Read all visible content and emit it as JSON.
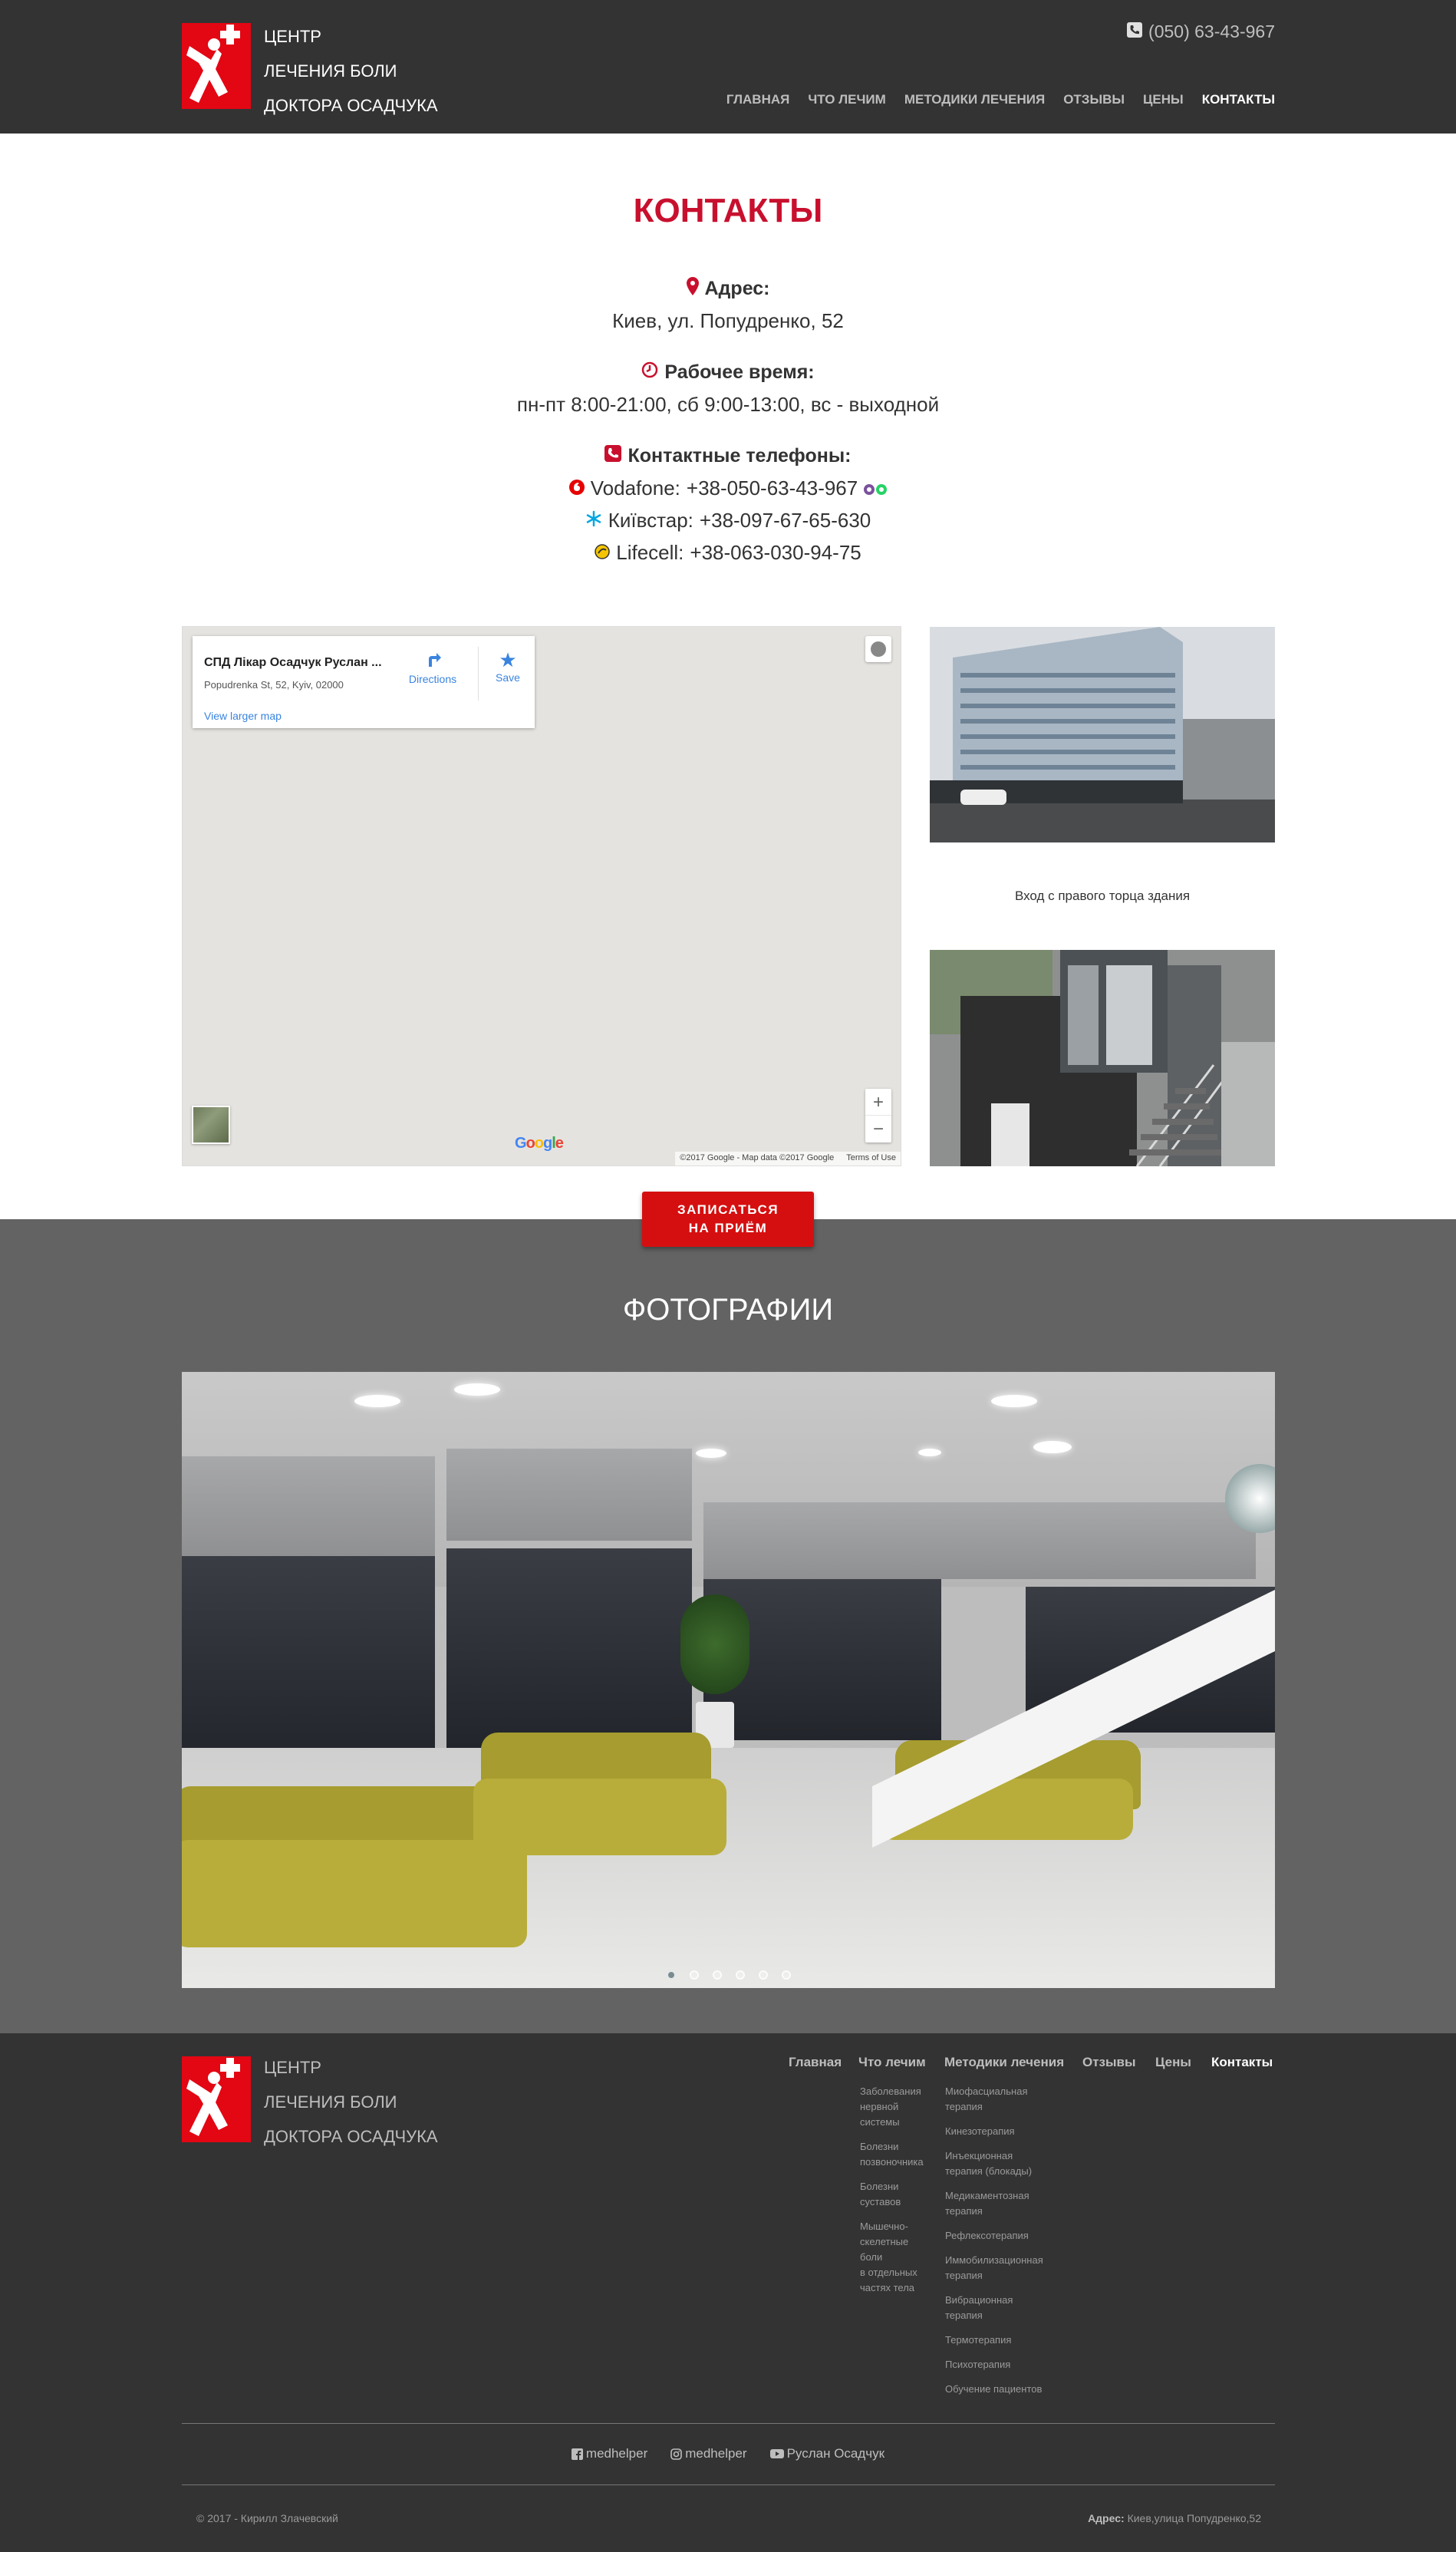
{
  "header": {
    "logo_lines": [
      "ЦЕНТР",
      "ЛЕЧЕНИЯ БОЛИ",
      "ДОКТОРА ОСАДЧУКА"
    ],
    "phone": "(050) 63-43-967",
    "nav": [
      {
        "label": "ГЛАВНАЯ",
        "active": false
      },
      {
        "label": "ЧТО ЛЕЧИМ",
        "active": false
      },
      {
        "label": "МЕТОДИКИ ЛЕЧЕНИЯ",
        "active": false
      },
      {
        "label": "ОТЗЫВЫ",
        "active": false
      },
      {
        "label": "ЦЕНЫ",
        "active": false
      },
      {
        "label": "КОНТАКТЫ",
        "active": true
      }
    ]
  },
  "contacts": {
    "title": "КОНТАКТЫ",
    "address_label": "Адрес:",
    "address": "Киев, ул. Попудренко, 52",
    "hours_label": "Рабочее время:",
    "hours": "пн-пт 8:00-21:00, сб 9:00-13:00, вс - выходной",
    "phones_label": "Контактные телефоны:",
    "phones": [
      {
        "operator": "Vodafone:",
        "number": "+38-050-63-43-967",
        "icon": "vodafone-icon"
      },
      {
        "operator": "Київстар:",
        "number": "+38-097-67-65-630",
        "icon": "kyivstar-icon"
      },
      {
        "operator": "Lifecell:",
        "number": "+38-063-030-94-75",
        "icon": "lifecell-icon"
      }
    ]
  },
  "map": {
    "place_name": "СПД Лікар Осадчук Руслан ...",
    "place_address": "Popudrenka St, 52, Kyiv, 02000",
    "directions_label": "Directions",
    "save_label": "Save",
    "larger_map_label": "View larger map",
    "zoom_in": "+",
    "zoom_out": "−",
    "google_label": "Google",
    "attribution": "©2017 Google - Map data ©2017 Google",
    "terms": "Terms of Use"
  },
  "entrance_caption": "Вход с правого торца здания",
  "cta": {
    "line1": "ЗАПИСАТЬСЯ",
    "line2": "НА ПРИЁМ"
  },
  "gallery": {
    "title": "ФОТОГРАФИИ",
    "slide_count": 6,
    "active_slide": 1
  },
  "footer": {
    "logo_lines": [
      "ЦЕНТР",
      "ЛЕЧЕНИЯ БОЛИ",
      "ДОКТОРА ОСАДЧУКА"
    ],
    "nav": [
      {
        "label": "Главная",
        "active": false
      },
      {
        "label": "Что лечим",
        "active": false
      },
      {
        "label": "Методики лечения",
        "active": false
      },
      {
        "label": "Отзывы",
        "active": false
      },
      {
        "label": "Цены",
        "active": false
      },
      {
        "label": "Контакты",
        "active": true
      }
    ],
    "what_we_treat": [
      [
        "Заболевания",
        "нервной",
        "системы"
      ],
      [
        "Болезни",
        "позвоночника"
      ],
      [
        "Болезни",
        "суставов"
      ],
      [
        "Мышечно-",
        "скелетные",
        "боли",
        "в отдельных",
        "частях тела"
      ]
    ],
    "methods": [
      [
        "Миофасциальная",
        "терапия"
      ],
      [
        "Кинезотерапия"
      ],
      [
        "Инъекционная",
        "терапия (блокады)"
      ],
      [
        "Медикаментозная",
        "терапия"
      ],
      [
        "Рефлексотерапия"
      ],
      [
        "Иммобилизационная",
        "терапия"
      ],
      [
        "Вибрационная",
        "терапия"
      ],
      [
        "Термотерапия"
      ],
      [
        "Психотерапия"
      ],
      [
        "Обучение пациентов"
      ]
    ],
    "social": [
      {
        "label": "medhelper",
        "icon": "facebook-icon"
      },
      {
        "label": "medhelper",
        "icon": "instagram-icon"
      },
      {
        "label": "Руслан Осадчук",
        "icon": "youtube-icon"
      }
    ],
    "copyright": "© 2017 - Кирилл Злачевский",
    "address_label": "Адрес:",
    "address": "Киев,улица Попудренко,52"
  }
}
